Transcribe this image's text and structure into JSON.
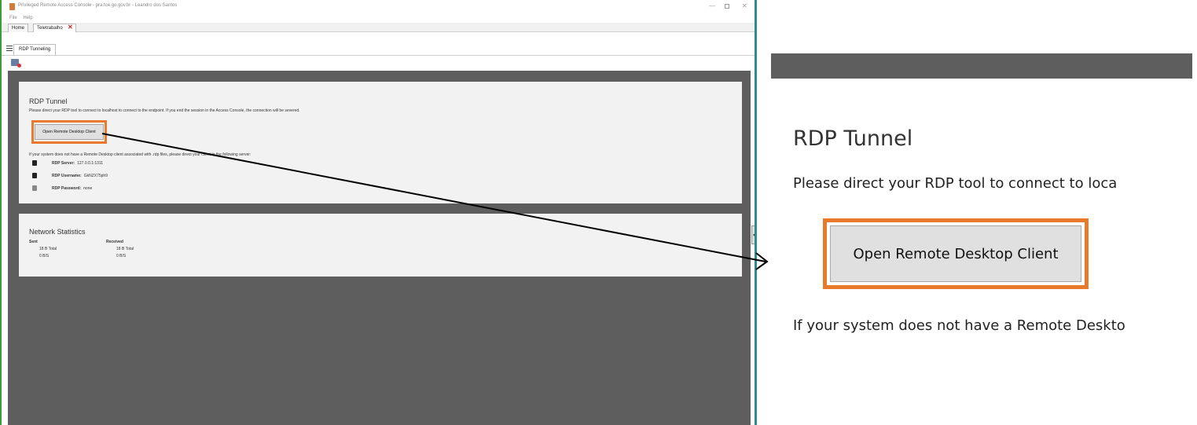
{
  "window": {
    "title": "Privileged Remote Access Console - pra.tce.go.gov.br - Leandro dos Santos"
  },
  "menu": {
    "items": [
      "File",
      "Help"
    ]
  },
  "tabs": [
    {
      "label": "Home"
    },
    {
      "label": "Teletrabalho"
    }
  ],
  "subtabs": [
    {
      "label": "RDP Tunneling"
    }
  ],
  "rdp_panel": {
    "title": "RDP Tunnel",
    "instructions": "Please direct your RDP tool to connect to localhost to connect to the endpoint. If you end the session in the Access Console, the connection will be severed.",
    "button_label": "Open Remote Desktop Client",
    "fallback_text": "If your system does not have a Remote Desktop client associated with .rdp files, please direct your client to the following server:",
    "credentials": [
      {
        "label": "RDP Server:",
        "value": "127.0.0.1:1311"
      },
      {
        "label": "RDP Username:",
        "value": "GkNZX75ph9"
      },
      {
        "label": "RDP Password:",
        "value": "none"
      }
    ]
  },
  "network_panel": {
    "title": "Network Statistics",
    "sent_header": "Sent",
    "received_header": "Received",
    "sent_total": "18 B Total",
    "sent_rate": "0 B/S",
    "received_total": "18 B Total",
    "received_rate": "0 B/S"
  },
  "zoom": {
    "title": "RDP Tunnel",
    "instructions": "Please direct your RDP tool to connect to loca",
    "button_label": "Open Remote Desktop Client",
    "fallback_text": "If your system does not have a Remote Deskto"
  },
  "colors": {
    "highlight": "#e87a2e",
    "content_bg": "#5e5e5e",
    "panel_bg": "#f2f2f2"
  }
}
